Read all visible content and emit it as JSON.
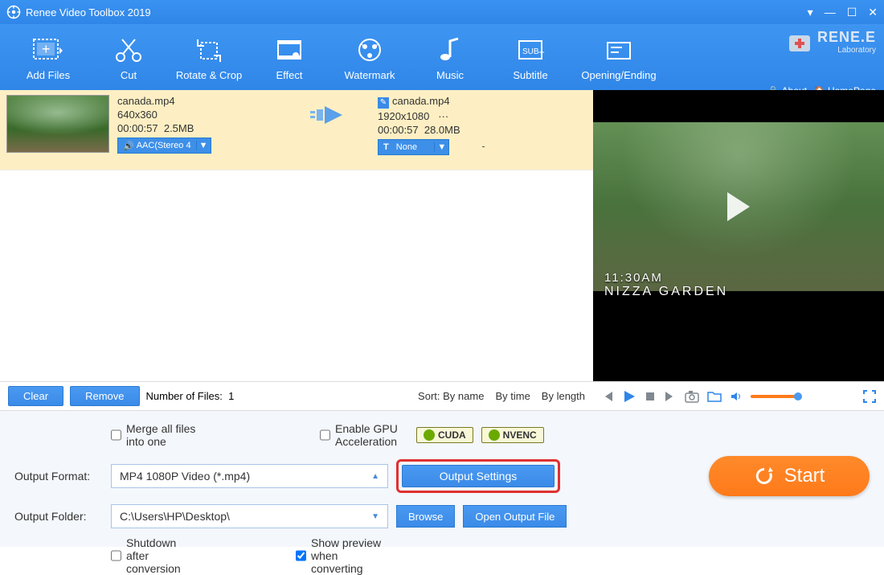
{
  "title": "Renee Video Toolbox 2019",
  "brand": {
    "name": "RENE.E",
    "sub": "Laboratory",
    "about": "About",
    "homepage": "HomePage"
  },
  "toolbar": [
    {
      "label": "Add Files"
    },
    {
      "label": "Cut"
    },
    {
      "label": "Rotate & Crop"
    },
    {
      "label": "Effect"
    },
    {
      "label": "Watermark"
    },
    {
      "label": "Music"
    },
    {
      "label": "Subtitle"
    },
    {
      "label": "Opening/Ending"
    }
  ],
  "file": {
    "src": {
      "name": "canada.mp4",
      "res": "640x360",
      "dur": "00:00:57",
      "size": "2.5MB"
    },
    "dst": {
      "name": "canada.mp4",
      "res": "1920x1080",
      "more": "···",
      "dur": "00:00:57",
      "size": "28.0MB"
    },
    "audio": "AAC(Stereo 4",
    "subtitle": "None",
    "dash": "-"
  },
  "preview": {
    "time": "11:30AM",
    "place": "NIZZA GARDEN"
  },
  "listfooter": {
    "clear": "Clear",
    "remove": "Remove",
    "count_label": "Number of Files:",
    "count": "1",
    "sort_label": "Sort:",
    "by_name": "By name",
    "by_time": "By time",
    "by_length": "By length"
  },
  "options": {
    "merge": "Merge all files into one",
    "gpu": "Enable GPU Acceleration",
    "cuda": "CUDA",
    "nvenc": "NVENC",
    "format_label": "Output Format:",
    "format_value": "MP4 1080P Video (*.mp4)",
    "output_settings": "Output Settings",
    "folder_label": "Output Folder:",
    "folder_value": "C:\\Users\\HP\\Desktop\\",
    "browse": "Browse",
    "open_output": "Open Output File",
    "shutdown": "Shutdown after conversion",
    "show_preview": "Show preview when converting",
    "start": "Start"
  }
}
